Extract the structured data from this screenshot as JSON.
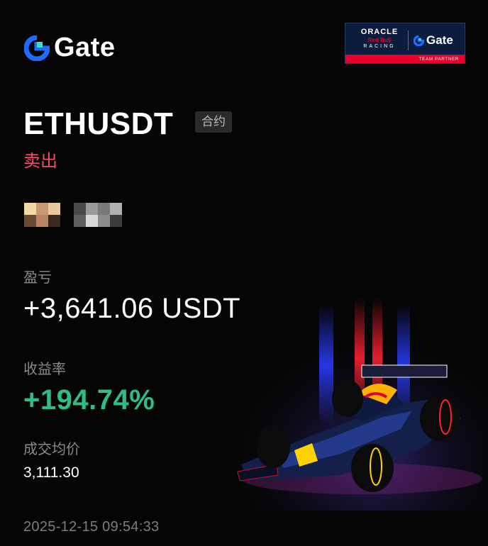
{
  "brand": {
    "logo_text": "Gate",
    "accent": "#1d6bff",
    "accent2": "#3fdcc0"
  },
  "partner": {
    "oracle": "ORACLE",
    "redbull": "Red Bull",
    "racing": "RACING",
    "gate": "Gate",
    "team_partner": "TEAM PARTNER"
  },
  "trade": {
    "symbol": "ETHUSDT",
    "tag": "合约",
    "side": "卖出",
    "side_color": "#f0506e"
  },
  "stats": {
    "pnl_label": "盈亏",
    "pnl_value": "+3,641.06 USDT",
    "rate_label": "收益率",
    "rate_value": "+194.74%",
    "rate_color": "#2ebd85",
    "price_label": "成交均价",
    "price_value": "3,111.30",
    "timestamp": "2025-12-15 09:54:33"
  },
  "hero": {
    "car_livery": "7 Gate",
    "description": "race-car-image"
  }
}
